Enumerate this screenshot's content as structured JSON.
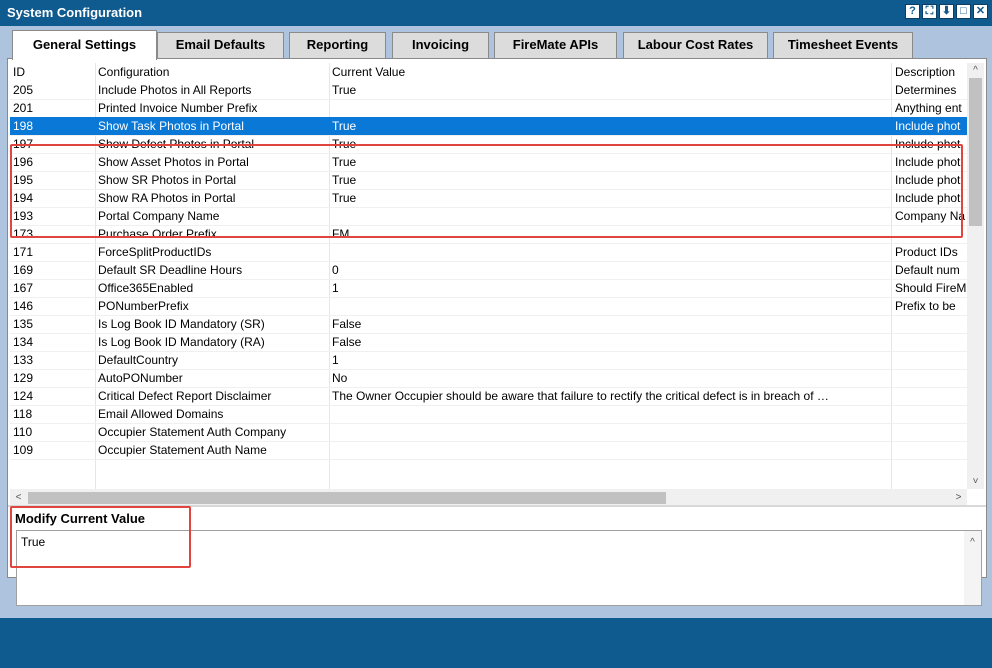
{
  "window": {
    "title": "System Configuration",
    "buttons": [
      "?",
      "⛶",
      "⬇",
      "□",
      "✕"
    ]
  },
  "tabs": [
    {
      "label": "General Settings",
      "active": true
    },
    {
      "label": "Email Defaults"
    },
    {
      "label": "Reporting"
    },
    {
      "label": "Invoicing"
    },
    {
      "label": "FireMate APIs"
    },
    {
      "label": "Labour Cost Rates"
    },
    {
      "label": "Timesheet Events"
    }
  ],
  "grid": {
    "columns": [
      "ID",
      "Configuration",
      "Current Value",
      "Description"
    ],
    "rows": [
      {
        "id": "205",
        "config": "Include Photos in All Reports",
        "value": "True",
        "desc": "Determines"
      },
      {
        "id": "201",
        "config": "Printed Invoice Number Prefix",
        "value": "",
        "desc": "Anything ent"
      },
      {
        "id": "198",
        "config": "Show Task Photos in Portal",
        "value": "True",
        "desc": "Include phot",
        "selected": true
      },
      {
        "id": "197",
        "config": "Show Defect Photos in Portal",
        "value": "True",
        "desc": "Include phot"
      },
      {
        "id": "196",
        "config": "Show Asset Photos in Portal",
        "value": "True",
        "desc": "Include phot"
      },
      {
        "id": "195",
        "config": "Show SR Photos in Portal",
        "value": "True",
        "desc": "Include phot"
      },
      {
        "id": "194",
        "config": "Show RA Photos in Portal",
        "value": "True",
        "desc": "Include phot"
      },
      {
        "id": "193",
        "config": "Portal Company Name",
        "value": "",
        "desc": "Company Na"
      },
      {
        "id": "173",
        "config": "Purchase Order Prefix",
        "value": "FM",
        "desc": ""
      },
      {
        "id": "171",
        "config": "ForceSplitProductIDs",
        "value": "",
        "desc": "Product IDs"
      },
      {
        "id": "169",
        "config": "Default SR Deadline Hours",
        "value": "0",
        "desc": "Default num"
      },
      {
        "id": "167",
        "config": "Office365Enabled",
        "value": "1",
        "desc": "Should FireM"
      },
      {
        "id": "146",
        "config": "PONumberPrefix",
        "value": "",
        "desc": "Prefix to be"
      },
      {
        "id": "135",
        "config": "Is Log Book ID Mandatory (SR)",
        "value": "False",
        "desc": ""
      },
      {
        "id": "134",
        "config": "Is Log Book ID Mandatory (RA)",
        "value": "False",
        "desc": ""
      },
      {
        "id": "133",
        "config": "DefaultCountry",
        "value": "1",
        "desc": ""
      },
      {
        "id": "129",
        "config": "AutoPONumber",
        "value": "No",
        "desc": ""
      },
      {
        "id": "124",
        "config": "Critical Defect Report Disclaimer",
        "value": "The Owner Occupier should be aware that failure to rectify the critical defect is in breach of …",
        "desc": ""
      },
      {
        "id": "118",
        "config": "Email Allowed Domains",
        "value": "",
        "desc": ""
      },
      {
        "id": "110",
        "config": "Occupier Statement Auth Company",
        "value": "",
        "desc": ""
      },
      {
        "id": "109",
        "config": "Occupier Statement Auth Name",
        "value": "",
        "desc": ""
      }
    ]
  },
  "modify": {
    "title": "Modify Current Value",
    "value": "True"
  },
  "scroll": {
    "up": "^",
    "down": "˅",
    "left": "<",
    "right": ">"
  }
}
